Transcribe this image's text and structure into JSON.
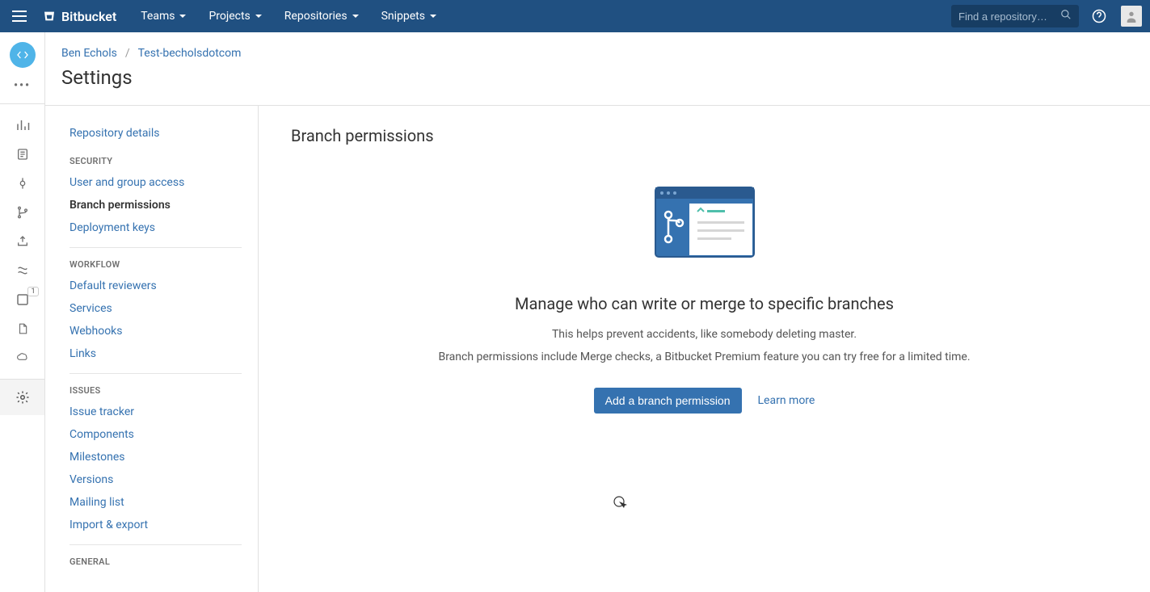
{
  "topbar": {
    "brand": "Bitbucket",
    "nav": [
      "Teams",
      "Projects",
      "Repositories",
      "Snippets"
    ],
    "search_placeholder": "Find a repository…"
  },
  "breadcrumb": {
    "owner": "Ben Echols",
    "repo": "Test-becholsdotcom"
  },
  "page_title": "Settings",
  "settings_nav": {
    "top": "Repository details",
    "security": {
      "header": "SECURITY",
      "items": [
        "User and group access",
        "Branch permissions",
        "Deployment keys"
      ],
      "active": "Branch permissions"
    },
    "workflow": {
      "header": "WORKFLOW",
      "items": [
        "Default reviewers",
        "Services",
        "Webhooks",
        "Links"
      ]
    },
    "issues": {
      "header": "ISSUES",
      "items": [
        "Issue tracker",
        "Components",
        "Milestones",
        "Versions",
        "Mailing list",
        "Import & export"
      ]
    },
    "general": {
      "header": "GENERAL"
    }
  },
  "main": {
    "title": "Branch permissions",
    "heading": "Manage who can write or merge to specific branches",
    "desc1": "This helps prevent accidents, like somebody deleting master.",
    "desc2": "Branch permissions include Merge checks, a Bitbucket Premium feature you can try free for a limited time.",
    "primary_btn": "Add a branch permission",
    "secondary_link": "Learn more"
  },
  "rail_badge": "1"
}
